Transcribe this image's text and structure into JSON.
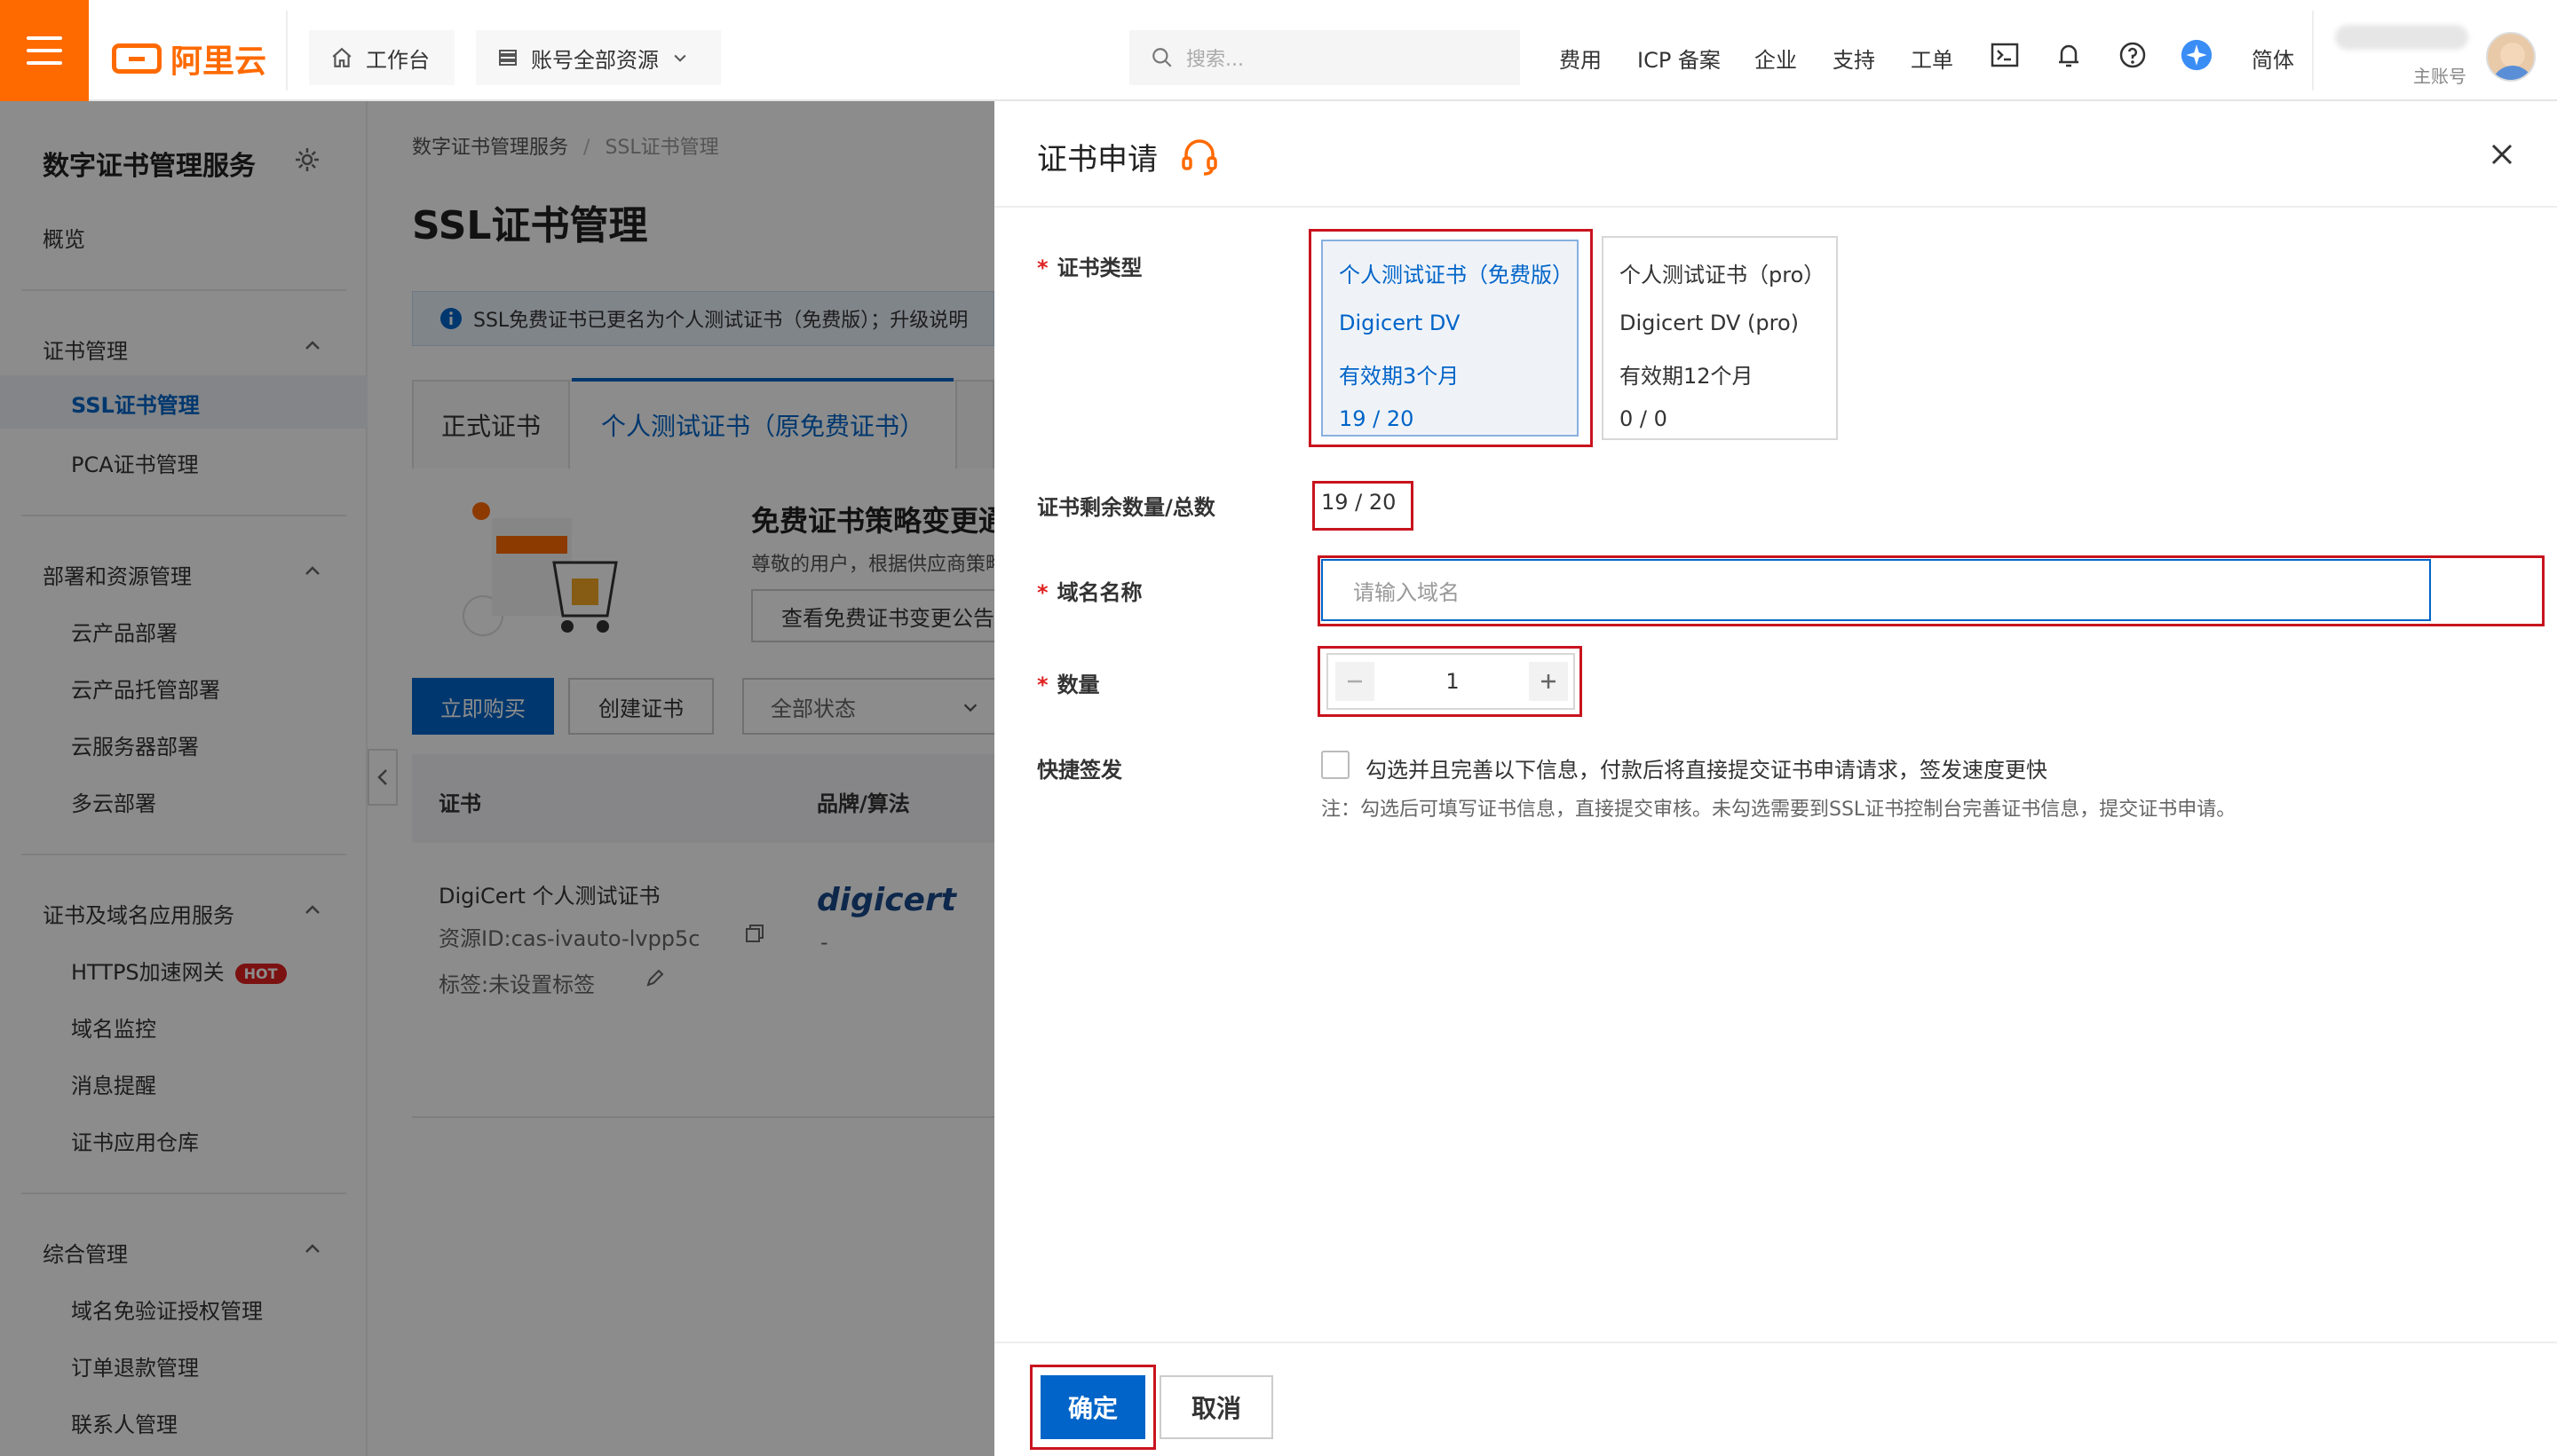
{
  "topbar": {
    "logo_text": "阿里云",
    "workbench": "工作台",
    "resources": "账号全部资源",
    "search_placeholder": "搜索...",
    "nav": [
      "费用",
      "ICP 备案",
      "企业",
      "支持",
      "工单"
    ],
    "lang": "简体",
    "account_role": "主账号",
    "brand_color": "#ff6a00"
  },
  "sidebar": {
    "title": "数字证书管理服务",
    "overview": "概览",
    "group1": "证书管理",
    "g1_items": [
      "SSL证书管理",
      "PCA证书管理"
    ],
    "group2": "部署和资源管理",
    "g2_items": [
      "云产品部署",
      "云产品托管部署",
      "云服务器部署",
      "多云部署"
    ],
    "group3": "证书及域名应用服务",
    "g3_items": [
      "HTTPS加速网关",
      "域名监控",
      "消息提醒",
      "证书应用仓库"
    ],
    "hot": "HOT",
    "group4": "综合管理",
    "g4_items": [
      "域名免验证授权管理",
      "订单退款管理",
      "联系人管理"
    ]
  },
  "main": {
    "breadcrumb_1": "数字证书管理服务",
    "breadcrumb_sep": "/",
    "breadcrumb_2": "SSL证书管理",
    "title": "SSL证书管理",
    "notice": "SSL免费证书已更名为个人测试证书（免费版）；升级说明",
    "tab_formal": "正式证书",
    "tab_test": "个人测试证书（原免费证书）",
    "promo_title": "免费证书策略变更通知",
    "promo_desc": "尊敬的用户，根据供应商策略调整",
    "promo_btn": "查看免费证书变更公告",
    "buy_btn": "立即购买",
    "create_btn": "创建证书",
    "status_select": "全部状态",
    "col_cert": "证书",
    "col_brand": "品牌/算法",
    "row_name": "DigiCert 个人测试证书",
    "row_id": "资源ID:cas-ivauto-lvpp5c",
    "row_tag": "标签:未设置标签",
    "row_brand": "digicert",
    "row_dash": "-"
  },
  "panel": {
    "title": "证书申请",
    "type_label": "证书类型",
    "card1": {
      "name": "个人测试证书（免费版）",
      "brand": "Digicert DV",
      "validity": "有效期3个月",
      "count": "19 / 20"
    },
    "card2": {
      "name": "个人测试证书（pro）",
      "brand": "Digicert DV (pro)",
      "validity": "有效期12个月",
      "count": "0 / 0"
    },
    "remain_label": "证书剩余数量/总数",
    "remain_value": "19 / 20",
    "domain_label": "域名名称",
    "domain_placeholder": "请输入域名",
    "qty_label": "数量",
    "qty_value": "1",
    "fast_label": "快捷签发",
    "fast_check": "勾选并且完善以下信息，付款后将直接提交证书申请请求，签发速度更快",
    "fast_note": "注：勾选后可填写证书信息，直接提交审核。未勾选需要到SSL证书控制台完善证书信息，提交证书申请。",
    "confirm": "确定",
    "cancel": "取消",
    "primary_color": "#0064c8",
    "highlight_color": "#c8141e"
  }
}
